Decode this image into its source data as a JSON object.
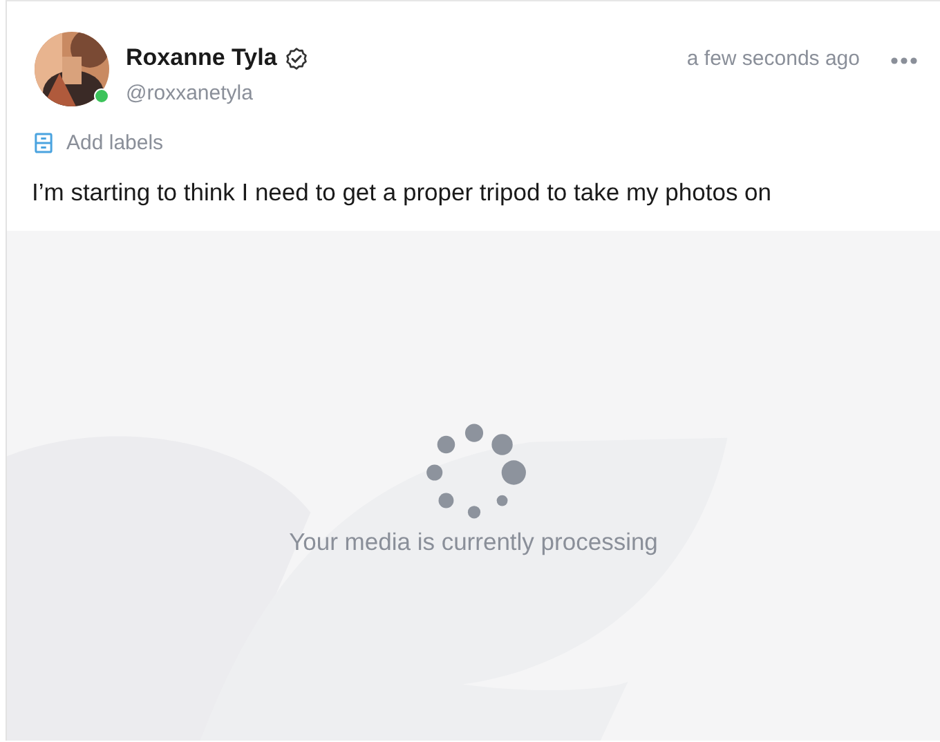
{
  "post": {
    "author": {
      "name": "Roxanne Tyla",
      "verified": true,
      "handle": "@roxxanetyla",
      "online": true
    },
    "time": "a few seconds ago",
    "labels_link": "Add labels",
    "text": "I’m starting to think I need to get a proper tripod to take my photos on",
    "media": {
      "processing": true,
      "message": "Your media is currently processing"
    }
  }
}
